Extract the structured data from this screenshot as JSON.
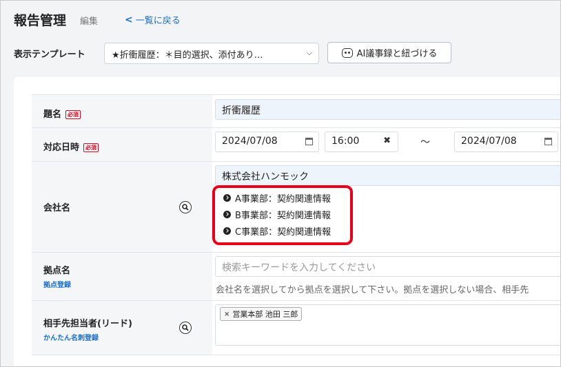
{
  "header": {
    "title": "報告管理",
    "mode": "編集",
    "back_label": "一覧に戻る"
  },
  "template": {
    "label": "表示テンプレート",
    "selected": "★折衝履歴：＊目的選択、添付あり…",
    "ai_button_label": "AI議事録と紐づける"
  },
  "form": {
    "required_badge": "必須",
    "subject": {
      "label": "題名",
      "value": "折衝履歴"
    },
    "datetime": {
      "label": "対応日時",
      "start_date": "2024/07/08",
      "start_time": "16:00",
      "separator": "〜",
      "end_date": "2024/07/08"
    },
    "company": {
      "label": "会社名",
      "value": "株式会社ハンモック",
      "departments": [
        "A事業部：契約関連情報",
        "B事業部：契約関連情報",
        "C事業部：契約関連情報"
      ]
    },
    "site": {
      "label": "拠点名",
      "link": "拠点登録",
      "placeholder": "検索キーワードを入力してください",
      "hint": "会社名を選択してから拠点を選択して下さい。拠点を選択しない場合、相手先"
    },
    "contact": {
      "label": "相手先担当者(リード)",
      "link": "かんたん名刺登録",
      "tag": "営業本部 池田 三郎"
    }
  },
  "colors": {
    "link": "#1a6fc9",
    "required": "#d0021b",
    "highlight": "#e8001a",
    "input_bg": "#eef4fb"
  }
}
